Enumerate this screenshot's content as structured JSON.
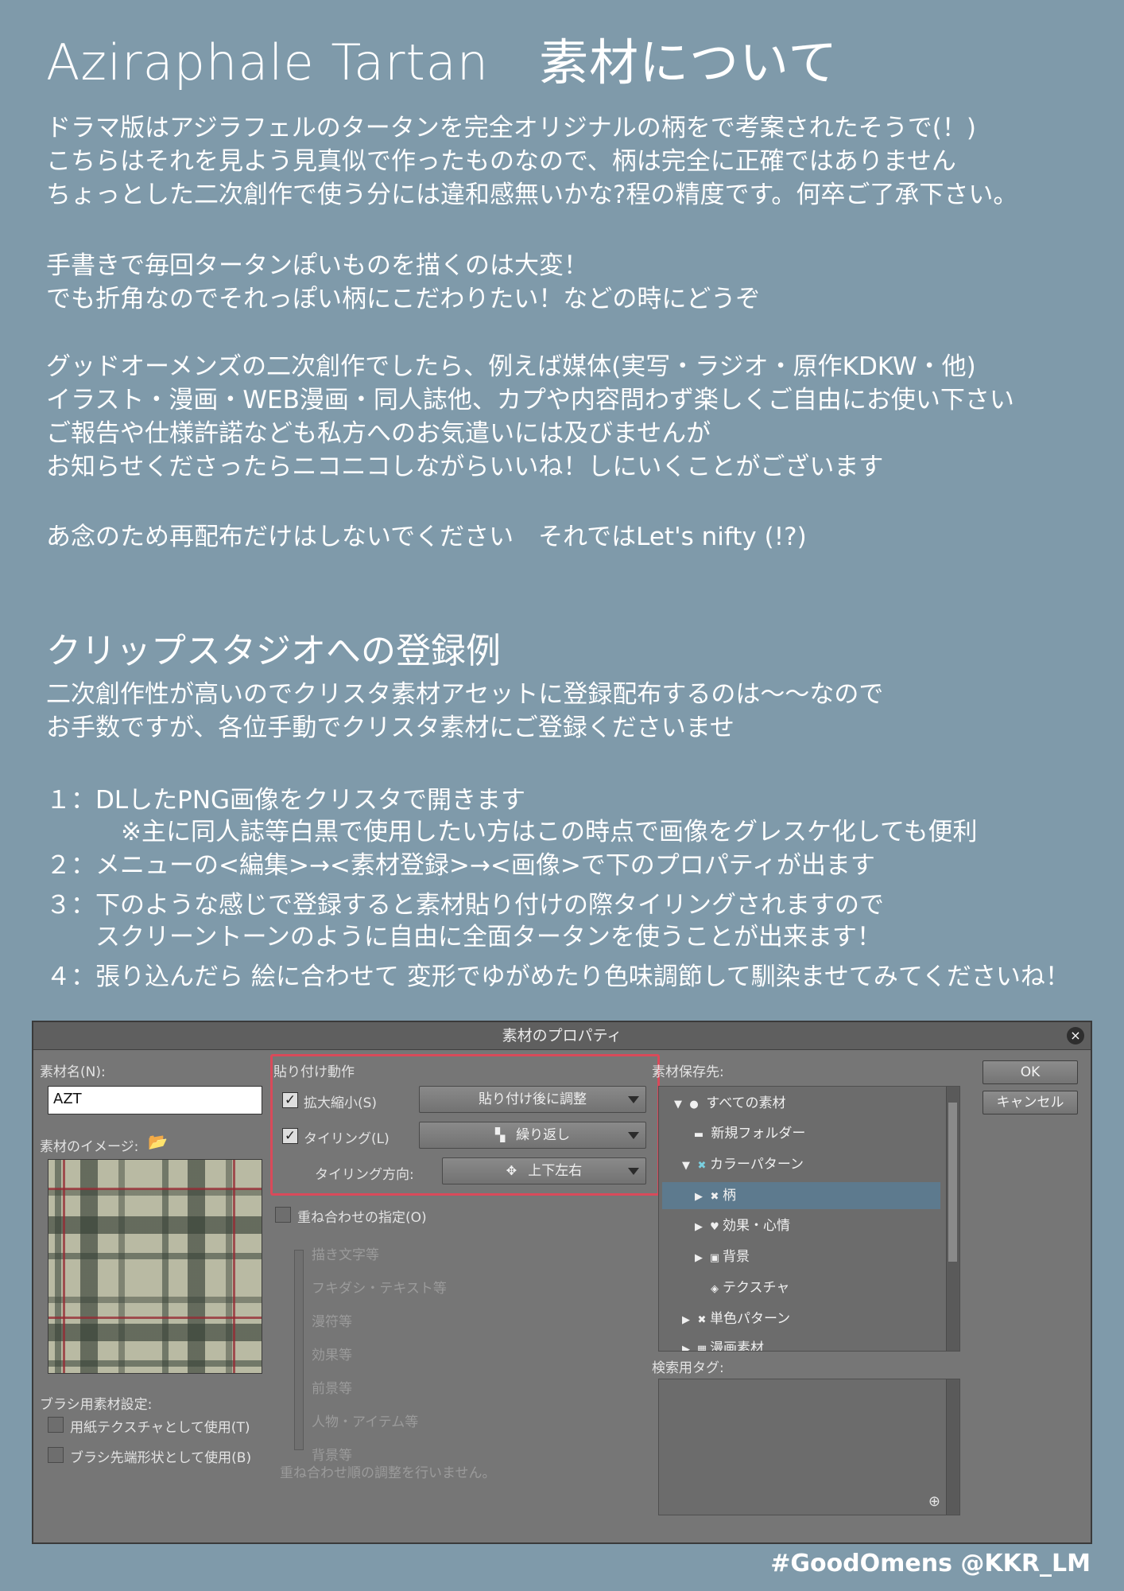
{
  "page": {
    "title": "Aziraphale Tartan　素材について",
    "intro": [
      "ドラマ版はアジラフェルのタータンを完全オリジナルの柄をで考案されたそうで(！)",
      "こちらはそれを見よう見真似で作ったものなので、柄は完全に正確ではありません",
      "ちょっとした二次創作で使う分には違和感無いかな?程の精度です。何卒ご了承下さい。"
    ],
    "para2": [
      "手書きで毎回タータンぽいものを描くのは大変！",
      "でも折角なのでそれっぽい柄にこだわりたい！などの時にどうぞ"
    ],
    "para3": [
      "グッドオーメンズの二次創作でしたら、例えば媒体(実写・ラジオ・原作KDKW・他)",
      "イラスト・漫画・WEB漫画・同人誌他、カプや内容問わず楽しくご自由にお使い下さい",
      "ご報告や仕様許諾なども私方へのお気遣いには及びませんが",
      "お知らせくださったらニコニコしながらいいね！しにいくことがございます"
    ],
    "para4": "あ念のため再配布だけはしないでください　それではLet's nifty (!?)",
    "section2_title": "クリップスタジオへの登録例",
    "section2_intro": [
      "二次創作性が高いのでクリスタ素材アセットに登録配布するのは〜〜なので",
      "お手数ですが、各位手動でクリスタ素材にご登録くださいませ"
    ],
    "steps": {
      "s1": "１：DLしたPNG画像をクリスタで開きます",
      "s1_note": "※主に同人誌等白黒で使用したい方はこの時点で画像をグレスケ化しても便利",
      "s2": "２：メニューの<編集>→<素材登録>→<画像>で下のプロパティが出ます",
      "s3": "３：下のような感じで登録すると素材貼り付けの際タイリングされますので",
      "s3_cont": "スクリーントーンのように自由に全面タータンを使うことが出来ます！",
      "s4": "４：張り込んだら 絵に合わせて 変形でゆがめたり色味調節して馴染ませてみてくださいね！"
    },
    "footer": "#GoodOmens  @KKR_LM"
  },
  "dialog": {
    "title": "素材のプロパティ",
    "close": "×",
    "name_label": "素材名(N):",
    "name_value": "AZT",
    "image_label": "素材のイメージ:",
    "brush_label": "ブラシ用素材設定:",
    "brush_opt1": "用紙テクスチャとして使用(T)",
    "brush_opt2": "ブラシ先端形状として使用(B)",
    "paste_label": "貼り付け動作",
    "scale_label": "拡大縮小(S)",
    "scale_value": "貼り付け後に調整",
    "tiling_label": "タイリング(L)",
    "tiling_value": "繰り返し",
    "tiling_dir_label": "タイリング方向:",
    "tiling_dir_value": "上下左右",
    "overlay_label": "重ね合わせの指定(O)",
    "overlay_items": [
      "描き文字等",
      "フキダシ・テキスト等",
      "漫符等",
      "効果等",
      "前景等",
      "人物・アイテム等",
      "背景等"
    ],
    "overlay_note": "重ね合わせ順の調整を行いません。",
    "save_label": "素材保存先:",
    "tree": [
      "すべての素材",
      "新規フォルダー",
      "カラーパターン",
      "柄",
      "効果・心情",
      "背景",
      "テクスチャ",
      "単色パターン",
      "漫画素材"
    ],
    "tag_label": "検索用タグ:",
    "ok": "OK",
    "cancel": "キャンセル"
  },
  "colors": {
    "page_bg": "#7f9aaa",
    "dialog_bg": "#767676",
    "highlight": "#d94a5a",
    "selection": "#5d7a8e"
  }
}
